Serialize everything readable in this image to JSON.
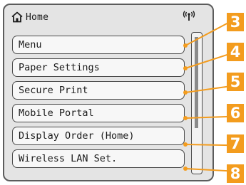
{
  "header": {
    "title": "Home",
    "home_icon": "home-icon",
    "signal_icon": "wireless-signal-icon"
  },
  "menu": {
    "items": [
      {
        "label": "Menu"
      },
      {
        "label": "Paper Settings"
      },
      {
        "label": "Secure Print"
      },
      {
        "label": "Mobile Portal"
      },
      {
        "label": "Display Order (Home)"
      },
      {
        "label": "Wireless LAN Set."
      }
    ]
  },
  "callouts": [
    "3",
    "4",
    "5",
    "6",
    "7",
    "8"
  ],
  "colors": {
    "accent": "#f39c1e",
    "screen_bg": "#e4e4e4",
    "button_bg": "#f7f7f7",
    "border": "#4a4a4a"
  }
}
